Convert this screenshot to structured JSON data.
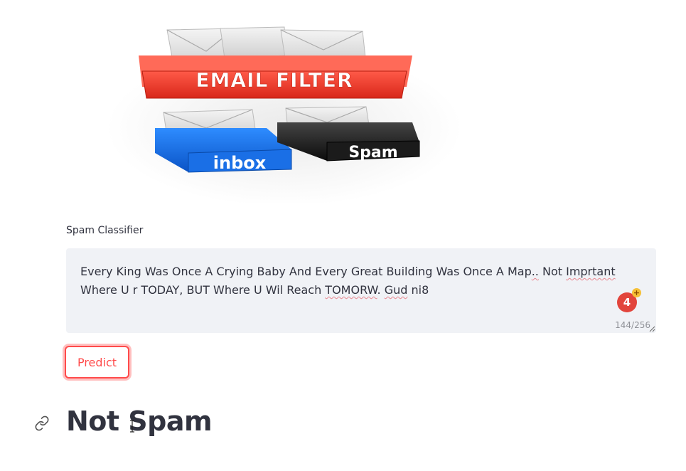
{
  "hero_image": {
    "banner_text": "EMAIL FILTER",
    "inbox_tray_text": "inbox",
    "spam_tray_text": "Spam"
  },
  "text_area": {
    "label": "Spam Classifier",
    "value_parts": [
      "Every King Was Once A Crying Baby And Every Great Building Was Once A Map",
      "..",
      " Not ",
      "Imprtant",
      " Where U r TODAY, BUT Where U Wil Reach ",
      "TOMORW",
      ". ",
      "Gud",
      " ni8"
    ],
    "char_count": "144/256",
    "grammarly_count": "4",
    "grammarly_plus": "+"
  },
  "predict_button": {
    "label": "Predict"
  },
  "result": {
    "heading": "Not Spam"
  },
  "colors": {
    "primary": "#ff4b4b",
    "text": "#31333f",
    "input_bg": "#f0f2f6",
    "grammarly": "#e2453c"
  }
}
